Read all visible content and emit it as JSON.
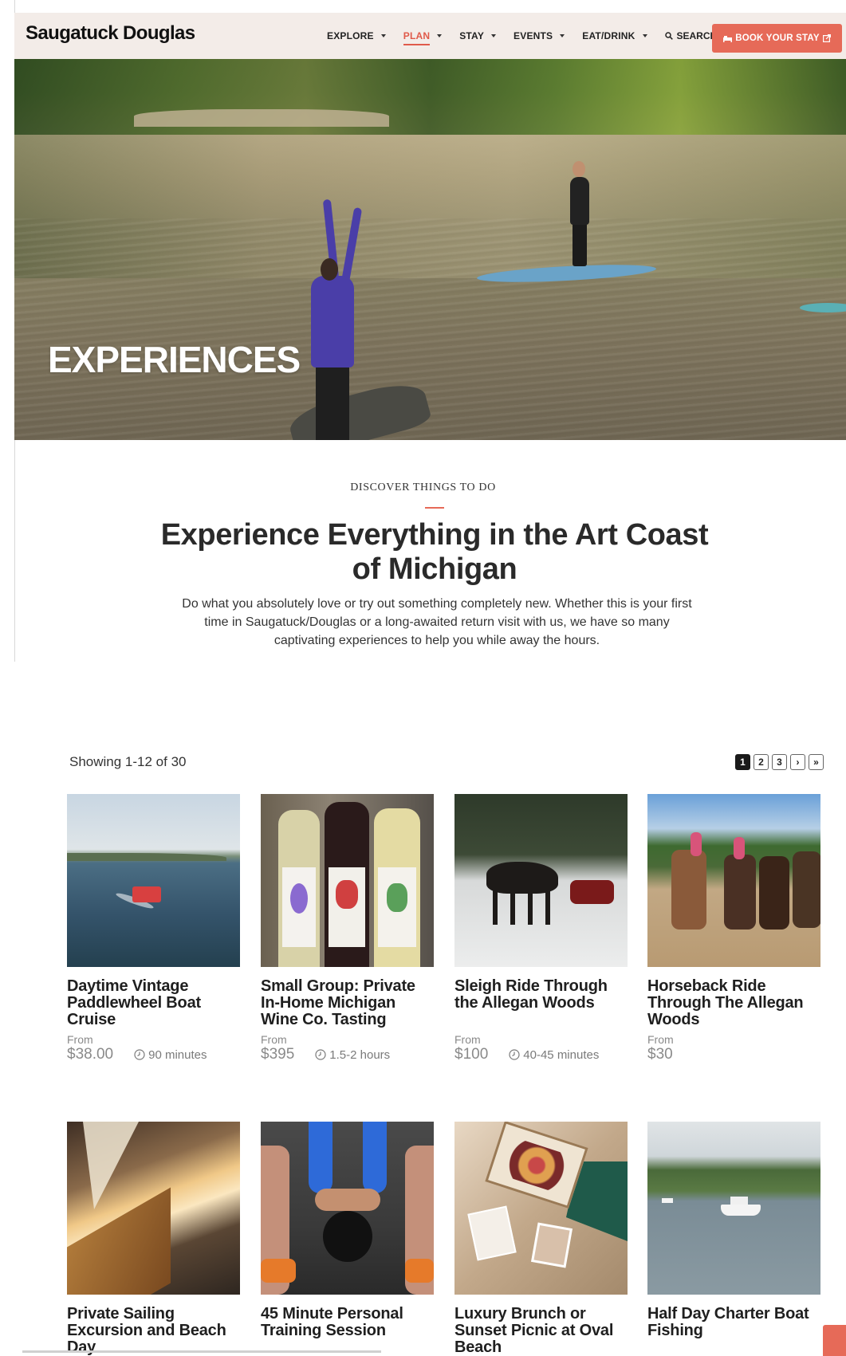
{
  "header": {
    "logo": "Saugatuck Douglas",
    "nav": [
      {
        "label": "EXPLORE",
        "active": false
      },
      {
        "label": "PLAN",
        "active": true
      },
      {
        "label": "STAY",
        "active": false
      },
      {
        "label": "EVENTS",
        "active": false
      },
      {
        "label": "EAT/DRINK",
        "active": false
      }
    ],
    "search_label": "SEARCH",
    "book_label": "BOOK YOUR STAY"
  },
  "hero": {
    "title": "EXPERIENCES"
  },
  "intro": {
    "eyebrow": "DISCOVER THINGS TO DO",
    "title": "Experience Everything in the Art Coast of Michigan",
    "body": "Do what you absolutely love or try out something completely new. Whether this is your first time in Saugatuck/Douglas or a long-awaited return visit with us, we have so many captivating experiences to help you while away the hours."
  },
  "listing": {
    "showing": "Showing 1-12 of 30",
    "pages": [
      "1",
      "2",
      "3"
    ],
    "current_page": "1",
    "next": "›",
    "last": "»",
    "cards": [
      {
        "title": "Daytime Vintage Paddlewheel Boat Cruise",
        "from": "From",
        "price": "$38.00",
        "duration": "90 minutes"
      },
      {
        "title": "Small Group: Private In-Home Michigan Wine Co. Tasting",
        "from": "From",
        "price": "$395",
        "duration": "1.5-2 hours"
      },
      {
        "title": "Sleigh Ride Through the Allegan Woods",
        "from": "From",
        "price": "$100",
        "duration": "40-45 minutes"
      },
      {
        "title": "Horseback Ride Through The Allegan Woods",
        "from": "From",
        "price": "$30",
        "duration": ""
      },
      {
        "title": "Private Sailing Excursion and Beach Day"
      },
      {
        "title": "45 Minute Personal Training Session"
      },
      {
        "title": "Luxury Brunch or Sunset Picnic at Oval Beach"
      },
      {
        "title": "Half Day Charter Boat Fishing"
      }
    ]
  },
  "colors": {
    "accent": "#e66a58",
    "header_bg": "#f3ece8",
    "text": "#222222"
  }
}
